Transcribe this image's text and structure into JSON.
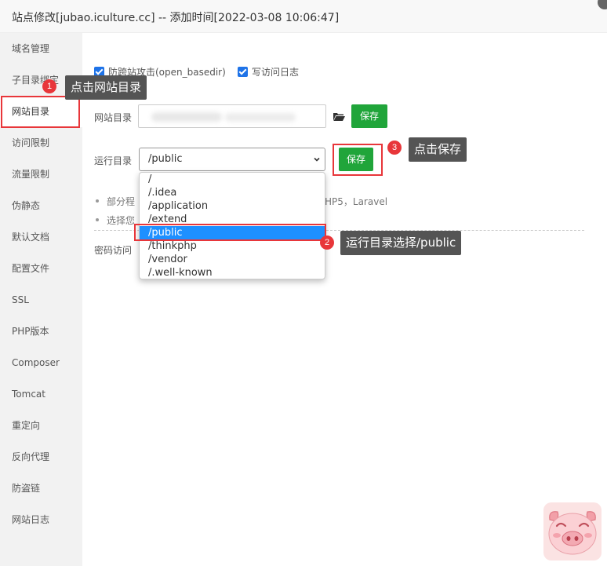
{
  "window": {
    "title": "站点修改[jubao.iculture.cc] -- 添加时间[2022-03-08 10:06:47]"
  },
  "sidebar": {
    "items": [
      {
        "label": "域名管理"
      },
      {
        "label": "子目录绑定"
      },
      {
        "label": "网站目录"
      },
      {
        "label": "访问限制"
      },
      {
        "label": "流量限制"
      },
      {
        "label": "伪静态"
      },
      {
        "label": "默认文档"
      },
      {
        "label": "配置文件"
      },
      {
        "label": "SSL"
      },
      {
        "label": "PHP版本"
      },
      {
        "label": "Composer"
      },
      {
        "label": "Tomcat"
      },
      {
        "label": "重定向"
      },
      {
        "label": "反向代理"
      },
      {
        "label": "防盗链"
      },
      {
        "label": "网站日志"
      }
    ],
    "active_index": 2
  },
  "options": {
    "anti_xss_label": "防跨站攻击(open_basedir)",
    "anti_xss_checked": true,
    "access_log_label": "写访问日志",
    "access_log_checked": true
  },
  "site_dir": {
    "label": "网站目录",
    "value": "",
    "save_label": "保存"
  },
  "run_dir": {
    "label": "运行目录",
    "selected": "/public",
    "save_label": "保存",
    "options": [
      "/",
      "/.idea",
      "/application",
      "/extend",
      "/public",
      "/thinkphp",
      "/vendor",
      "/.well-known"
    ]
  },
  "notes": {
    "line1_start": "部分程",
    "line1_end": "HP5，Laravel",
    "line2_start": "选择您"
  },
  "password_access": {
    "label": "密码访问"
  },
  "annotations": [
    {
      "number": "1",
      "text": "点击网站目录"
    },
    {
      "number": "2",
      "text": "运行目录选择/public"
    },
    {
      "number": "3",
      "text": "点击保存"
    }
  ],
  "colors": {
    "accent_green": "#20a53a",
    "highlight_red": "#e8363a",
    "selected_blue": "#1e90ff",
    "checkbox_blue": "#1e73e8"
  },
  "icons": {
    "folder": "folder-icon",
    "close": "close-icon",
    "mascot": "pig-mascot-icon"
  }
}
